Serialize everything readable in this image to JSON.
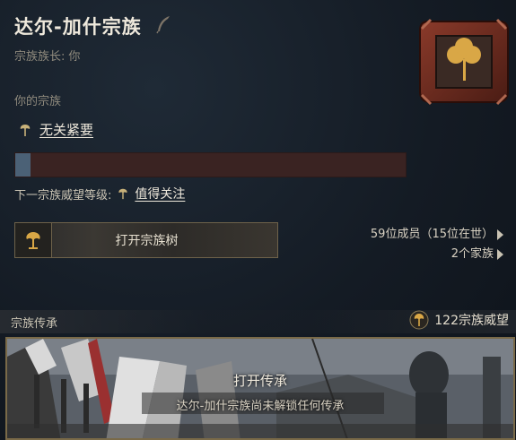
{
  "house": {
    "name": "达尔-加什宗族",
    "head_label": "宗族族长:",
    "head_value": "你"
  },
  "your_house_label": "你的宗族",
  "renown": {
    "current_level": "无关紧要",
    "progress": 0.04,
    "next_label": "下一宗族威望等级:",
    "next_level": "值得关注"
  },
  "tree_button": {
    "label": "打开宗族树"
  },
  "members": {
    "count_text": "59位成员（15位在世）",
    "houses_text": "2个家族"
  },
  "legacy": {
    "section_label": "宗族传承",
    "renown_text": "122宗族威望",
    "open_label": "打开传承",
    "note": "达尔-加什宗族尚未解锁任何传承"
  },
  "colors": {
    "accent_gold": "#c9a34f",
    "crest_red": "#6b2a1f",
    "bar_empty": "#3a2322",
    "bar_fill": "#4b6176"
  },
  "icons": [
    "quill-icon",
    "house-crest-icon",
    "renown-tree-icon",
    "family-tree-icon",
    "arrow-right-icon"
  ]
}
